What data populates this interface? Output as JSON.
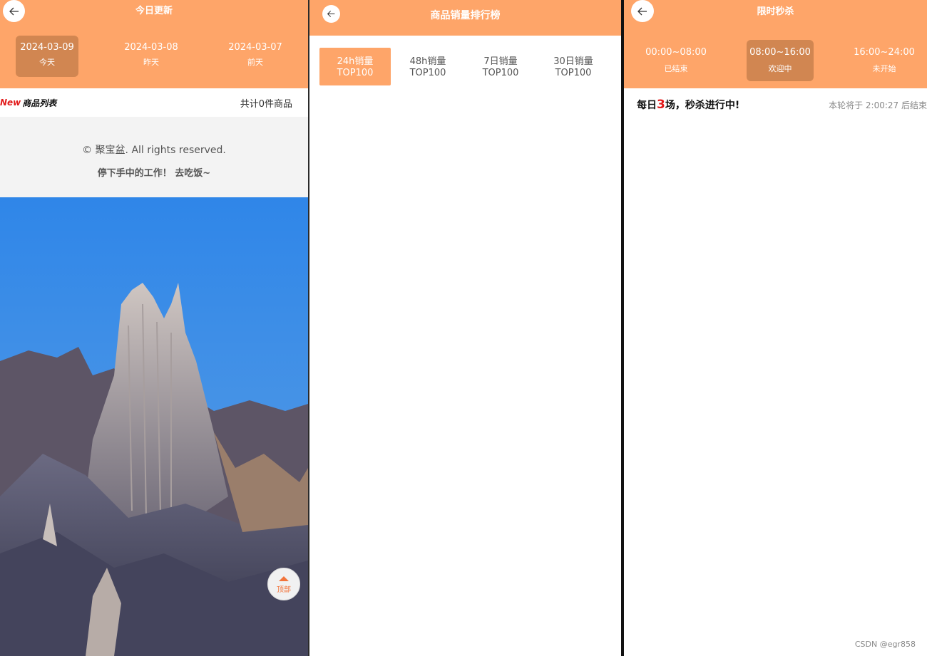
{
  "panel1": {
    "title": "今日更新",
    "dates": [
      {
        "date": "2024-03-09",
        "label": "今天",
        "active": true
      },
      {
        "date": "2024-03-08",
        "label": "昨天",
        "active": false
      },
      {
        "date": "2024-03-07",
        "label": "前天",
        "active": false
      }
    ],
    "list_logo_new": "New",
    "list_logo_text": "商品列表",
    "count_text": "共计0件商品",
    "footer_copyright": "© 聚宝盆. All rights reserved.",
    "footer_slogan": "停下手中的工作！ 去吃饭~",
    "top_button_label": "顶部"
  },
  "panel2": {
    "title": "商品销量排行榜",
    "tabs": [
      {
        "line1": "24h销量",
        "line2": "TOP100",
        "active": true
      },
      {
        "line1": "48h销量",
        "line2": "TOP100",
        "active": false
      },
      {
        "line1": "7日销量",
        "line2": "TOP100",
        "active": false
      },
      {
        "line1": "30日销量",
        "line2": "TOP100",
        "active": false
      }
    ]
  },
  "panel3": {
    "title": "限时秒杀",
    "slots": [
      {
        "time": "00:00~08:00",
        "status": "已结束",
        "active": false
      },
      {
        "time": "08:00~16:00",
        "status": "欢迎中",
        "active": true
      },
      {
        "time": "16:00~24:00",
        "status": "未开始",
        "active": false
      }
    ],
    "flash_prefix": "每日",
    "flash_number": "3",
    "flash_suffix": "场，秒杀进行中!",
    "remaining_text": "本轮将于 2:00:27 后结束"
  },
  "watermark": "CSDN @egr858",
  "colors": {
    "accent": "#fea569",
    "active_tab": "#d18651",
    "highlight": "#e21b1b"
  }
}
